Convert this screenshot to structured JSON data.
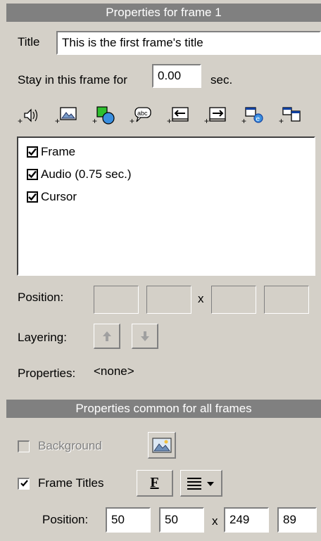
{
  "frame_panel": {
    "header": "Properties for frame 1",
    "title_label": "Title",
    "title_value": "This is the first frame's title",
    "stay_label": "Stay in this frame for",
    "stay_value": "0.00",
    "stay_unit": "sec.",
    "toolbar_icons": [
      "add-audio-icon",
      "add-image-icon",
      "add-shape-icon",
      "add-text-icon",
      "add-left-icon",
      "add-right-icon",
      "add-web-icon",
      "add-window-icon"
    ],
    "objects": [
      {
        "label": "Frame",
        "checked": true
      },
      {
        "label": "Audio (0.75 sec.)",
        "checked": true
      },
      {
        "label": "Cursor",
        "checked": true
      }
    ],
    "position_label": "Position:",
    "position_sep": "x",
    "layering_label": "Layering:",
    "properties_label": "Properties:",
    "properties_value": "<none>"
  },
  "common_panel": {
    "header": "Properties common for all frames",
    "background_label": "Background",
    "background_checked": false,
    "frame_titles_label": "Frame Titles",
    "frame_titles_checked": true,
    "font_button_label": "F",
    "position_label": "Position:",
    "position_sep": "x",
    "position_values": [
      "50",
      "50",
      "249",
      "89"
    ]
  },
  "colors": {
    "panel_bg": "#d4d0c8",
    "header_bg": "#808080",
    "header_text": "#ffffff",
    "disabled_text": "#808080"
  }
}
